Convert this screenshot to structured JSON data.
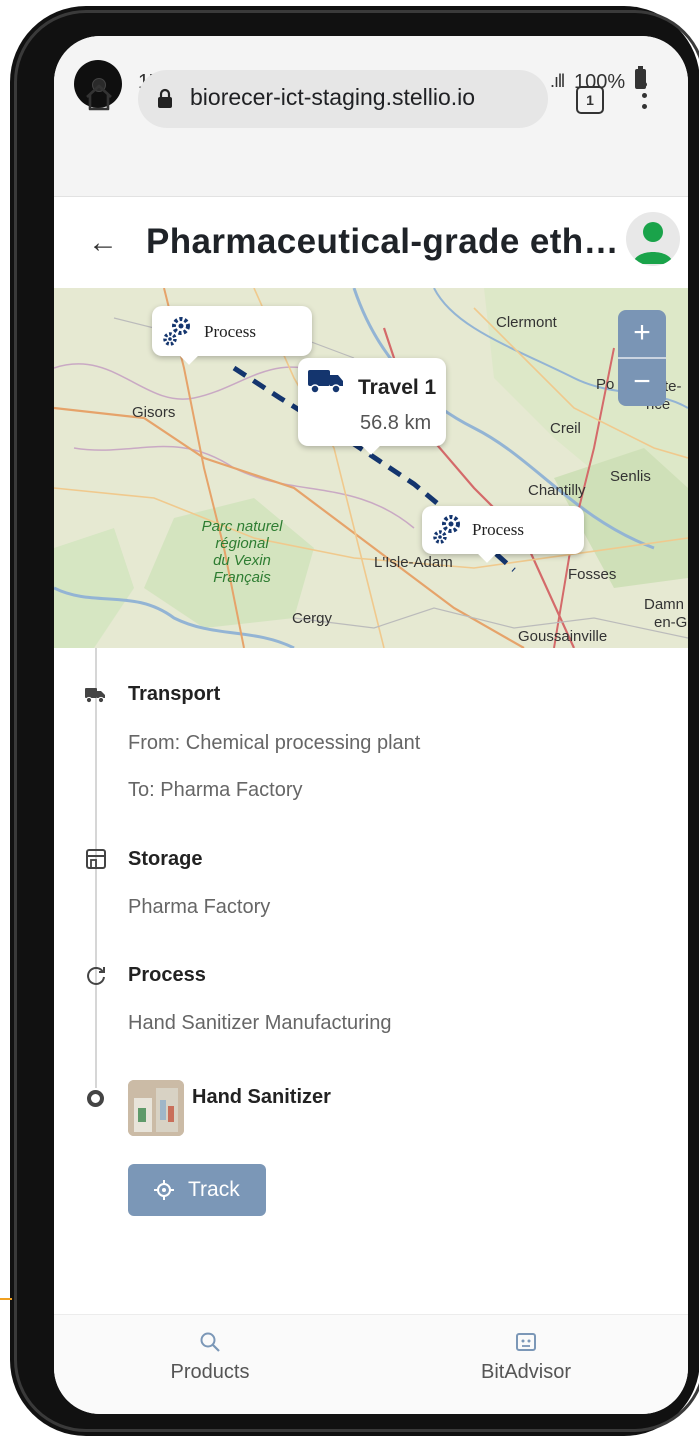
{
  "status_bar": {
    "time": "17:08",
    "signal": ".ıll",
    "battery": "100%"
  },
  "browser": {
    "url": "biorecer-ict-staging.stellio.io",
    "tab_count": "1"
  },
  "header": {
    "title": "Pharmaceutical-grade etha...",
    "back_icon": "arrow-left-icon",
    "avatar_icon": "user-icon",
    "avatar_color": "#1aa34a"
  },
  "map": {
    "popups": [
      {
        "label": "Process",
        "icon": "gears-icon"
      },
      {
        "title": "Travel 1",
        "distance": "56.8 km",
        "icon": "truck-icon"
      },
      {
        "label": "Process",
        "icon": "gears-icon"
      }
    ],
    "place_labels": [
      "Clermont",
      "Gisors",
      "Creil",
      "Chantilly",
      "Senlis",
      "L'Isle-Adam",
      "Fosses",
      "Cergy",
      "Goussainville",
      "Po",
      "te-",
      "nce",
      "Damn",
      "en-G"
    ],
    "park_label": [
      "Parc naturel",
      "régional",
      "du Vexin",
      "Français"
    ],
    "zoom_in": "+",
    "zoom_out": "−",
    "route_color": "#14356e"
  },
  "timeline": [
    {
      "icon": "truck-icon",
      "title": "Transport",
      "lines": [
        "From: Chemical processing plant",
        "To: Pharma Factory"
      ]
    },
    {
      "icon": "storefront-icon",
      "title": "Storage",
      "lines": [
        "Pharma Factory"
      ]
    },
    {
      "icon": "refresh-icon",
      "title": "Process",
      "lines": [
        "Hand Sanitizer Manufacturing"
      ]
    },
    {
      "icon": "circle-icon",
      "title": "Hand Sanitizer",
      "lines": []
    }
  ],
  "track_button": {
    "label": "Track",
    "icon": "crosshair-icon",
    "color": "#7b97b7"
  },
  "bottom_nav": [
    {
      "label": "Products",
      "icon": "search-icon"
    },
    {
      "label": "BitAdvisor",
      "icon": "robot-icon"
    }
  ]
}
